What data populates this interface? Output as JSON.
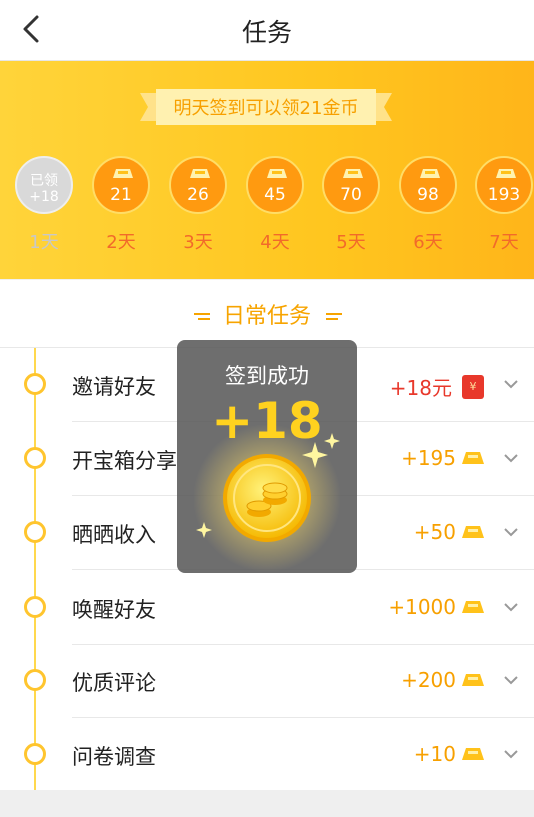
{
  "header": {
    "title": "任务",
    "back_icon": "back-arrow-icon"
  },
  "banner": {
    "ribbon_text": "明天签到可以领21金币",
    "days": [
      {
        "label": "1天",
        "status_text": "已领",
        "amount": "+18",
        "claimed": true
      },
      {
        "label": "2天",
        "amount": "21",
        "claimed": false
      },
      {
        "label": "3天",
        "amount": "26",
        "claimed": false
      },
      {
        "label": "4天",
        "amount": "45",
        "claimed": false
      },
      {
        "label": "5天",
        "amount": "70",
        "claimed": false
      },
      {
        "label": "6天",
        "amount": "98",
        "claimed": false
      },
      {
        "label": "7天",
        "amount": "193",
        "claimed": false
      }
    ]
  },
  "daily": {
    "title": "日常任务",
    "tasks": [
      {
        "name": "邀请好友",
        "reward": "+18元",
        "reward_icon": "red-envelope-icon",
        "envelope_symbol": "¥"
      },
      {
        "name": "开宝箱分享",
        "reward": "+195",
        "reward_icon": "gold-ingot-icon"
      },
      {
        "name": "晒晒收入",
        "reward": "+50",
        "reward_icon": "gold-ingot-icon"
      },
      {
        "name": "唤醒好友",
        "reward": "+1000",
        "reward_icon": "gold-ingot-icon"
      },
      {
        "name": "优质评论",
        "reward": "+200",
        "reward_icon": "gold-ingot-icon"
      },
      {
        "name": "问卷调查",
        "reward": "+10",
        "reward_icon": "gold-ingot-icon"
      }
    ]
  },
  "toast": {
    "text": "签到成功",
    "amount": "+18",
    "icon": "gold-coin-icon"
  },
  "colors": {
    "accent": "#ffc61f",
    "coin": "#ff9a10",
    "reward": "#f7a000",
    "reward_red": "#e8382b"
  }
}
